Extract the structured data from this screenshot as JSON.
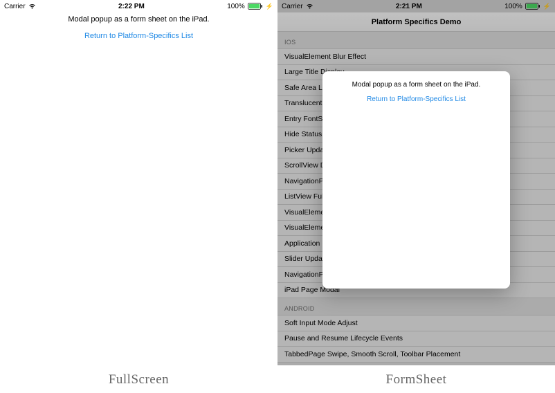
{
  "status": {
    "carrier": "Carrier",
    "time_left": "2:22 PM",
    "time_right": "2:21 PM",
    "battery": "100%"
  },
  "modal": {
    "message": "Modal popup as a form sheet on the iPad.",
    "return_link": "Return to Platform-Specifics List"
  },
  "nav_title": "Platform Specifics Demo",
  "sections": {
    "ios_header": "IOS",
    "android_header": "ANDROID"
  },
  "ios_items": [
    "VisualElement Blur Effect",
    "Large Title Display",
    "Safe Area Layout Guide",
    "Translucent Navigation Bar",
    "Entry FontSize",
    "Hide Status Bar",
    "Picker UpdateMode",
    "ScrollView Delays",
    "NavigationPage Translucent",
    "ListView FullWidth Separators",
    "VisualElement Drop Shadow",
    "VisualElement Legacy Color Mode",
    "Application PrefersStatusBarHidden",
    "Slider UpdateOnTap",
    "NavigationPage HideBackButtonTitle",
    "iPad Page Modal"
  ],
  "android_items": [
    "Soft Input Mode Adjust",
    "Pause and Resume Lifecycle Events",
    "TabbedPage Swipe, Smooth Scroll, Toolbar Placement"
  ],
  "captions": {
    "left": "FullScreen",
    "right": "FormSheet"
  }
}
